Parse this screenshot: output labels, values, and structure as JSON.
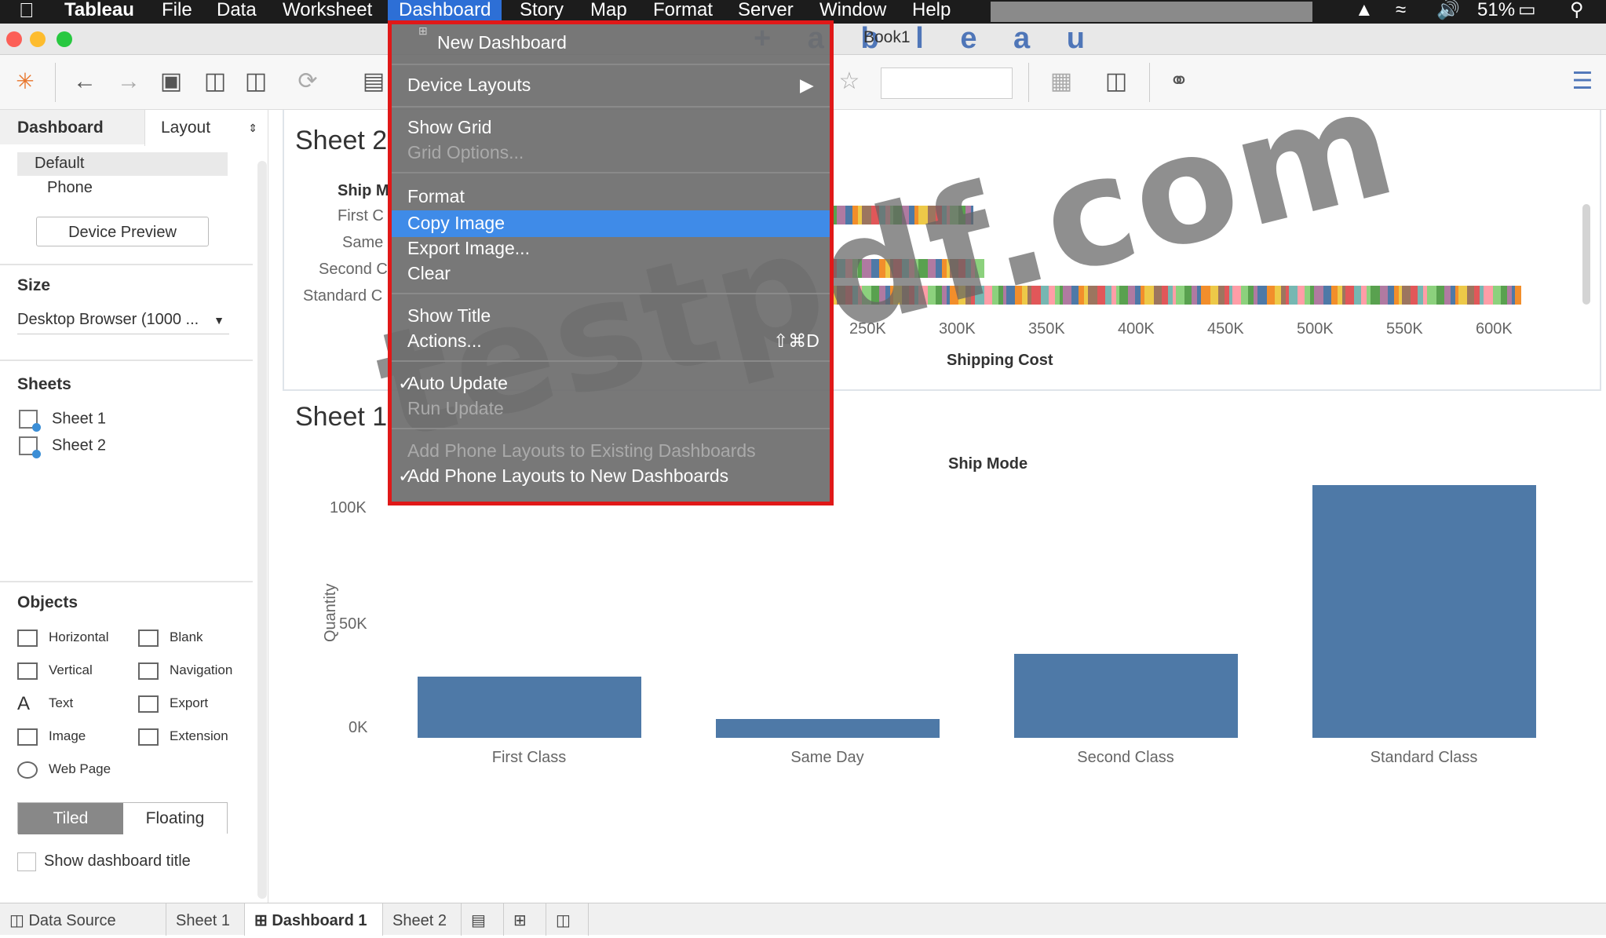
{
  "menubar": {
    "items": [
      "Tableau",
      "File",
      "Data",
      "Worksheet",
      "Dashboard",
      "Story",
      "Map",
      "Format",
      "Server",
      "Window",
      "Help"
    ],
    "battery": "51%"
  },
  "window": {
    "title": "Book1",
    "logo": "+ a b l e a u"
  },
  "left_panel": {
    "tabs": [
      "Dashboard",
      "Layout"
    ],
    "device": {
      "default": "Default",
      "phone": "Phone",
      "preview_button": "Device Preview"
    },
    "size": {
      "title": "Size",
      "value": "Desktop Browser (1000 ..."
    },
    "sheets": {
      "title": "Sheets",
      "items": [
        "Sheet 1",
        "Sheet 2"
      ]
    },
    "objects": {
      "title": "Objects",
      "items": [
        "Horizontal",
        "Blank",
        "Vertical",
        "Navigation",
        "Text",
        "Export",
        "Image",
        "Extension",
        "Web Page"
      ]
    },
    "layout_mode": {
      "tiled": "Tiled",
      "floating": "Floating"
    },
    "show_title": "Show dashboard title"
  },
  "sheet2": {
    "title": "Sheet 2",
    "row_header": "Ship M",
    "rows": [
      "First C",
      "Same",
      "Second C",
      "Standard C"
    ],
    "x_ticks": [
      "250K",
      "300K",
      "350K",
      "400K",
      "450K",
      "500K",
      "550K",
      "600K"
    ],
    "x_label": "Shipping Cost"
  },
  "sheet1": {
    "title": "Sheet 1",
    "header": "Ship Mode",
    "y_label": "Quantity",
    "y_ticks": [
      "100K",
      "50K",
      "0K"
    ]
  },
  "chart_data": {
    "type": "bar",
    "categories": [
      "First Class",
      "Same Day",
      "Second Class",
      "Standard Class"
    ],
    "values": [
      29000,
      9000,
      40000,
      120000
    ],
    "xlabel": "Ship Mode",
    "ylabel": "Quantity",
    "ylim": [
      0,
      120000
    ],
    "color": "#4e79a7"
  },
  "menu": {
    "items": [
      {
        "label": "New Dashboard",
        "disabled": false
      },
      {
        "label": "Device Layouts",
        "disabled": false,
        "submenu": true
      },
      {
        "label": "Show Grid",
        "disabled": false
      },
      {
        "label": "Grid Options...",
        "disabled": true
      },
      {
        "label": "Format",
        "disabled": false
      },
      {
        "label": "Copy Image",
        "disabled": false,
        "highlighted": true
      },
      {
        "label": "Export Image...",
        "disabled": false
      },
      {
        "label": "Clear",
        "disabled": false
      },
      {
        "label": "Show Title",
        "disabled": false
      },
      {
        "label": "Actions...",
        "disabled": false,
        "shortcut": "⇧⌘D"
      },
      {
        "label": "Auto Update",
        "disabled": false,
        "checked": true
      },
      {
        "label": "Run Update",
        "disabled": true
      },
      {
        "label": "Add Phone Layouts to Existing Dashboards",
        "disabled": true
      },
      {
        "label": "Add Phone Layouts to New Dashboards",
        "disabled": false,
        "checked": true
      }
    ]
  },
  "bottom_tabs": [
    "Data Source",
    "Sheet 1",
    "Dashboard 1",
    "Sheet 2"
  ],
  "watermark": "testpdf.com",
  "colors": {
    "accent": "#2d6fd6",
    "menu_highlight": "#3f8be8",
    "menu_border": "#e01818",
    "bar": "#4e79a7"
  }
}
